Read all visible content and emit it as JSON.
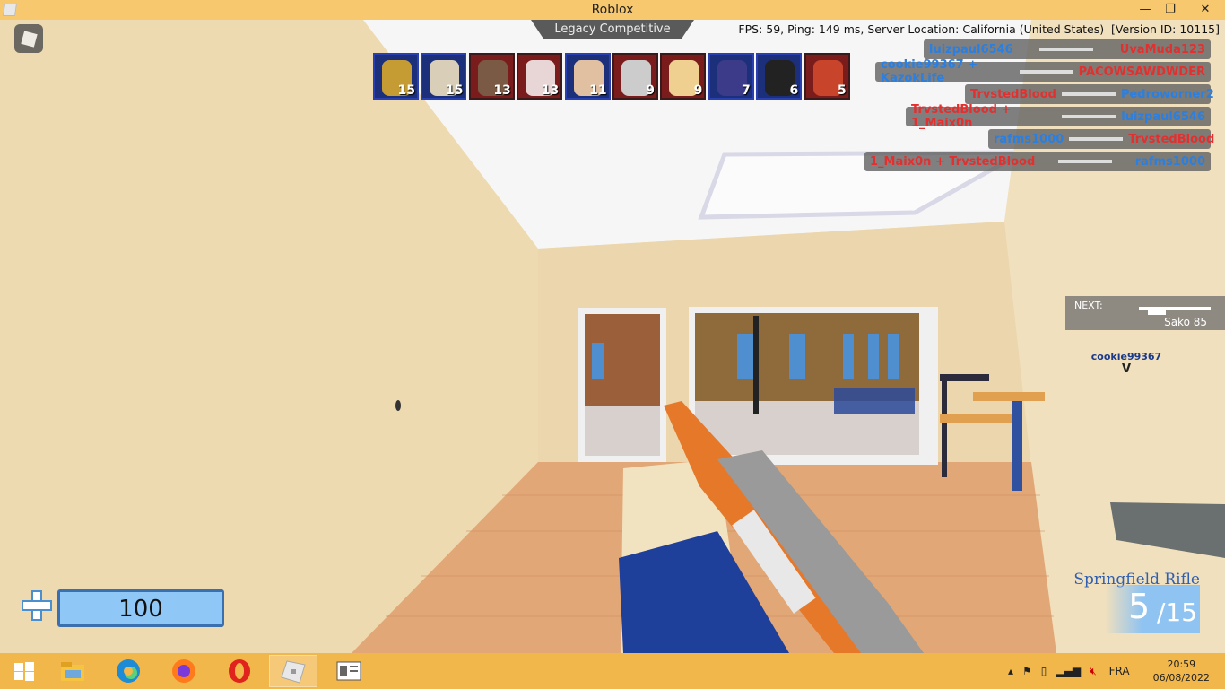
{
  "window": {
    "title": "Roblox",
    "min_icon": "minimize-icon",
    "max_icon": "maximize-icon",
    "close_icon": "close-icon"
  },
  "hud": {
    "mode": "Legacy Competitive",
    "stats": "FPS: 59, Ping: 149 ms, Server Location: California (United States)  [Version ID: 10115]",
    "players": [
      {
        "score": "15",
        "team": "blue",
        "face": "#c59b33"
      },
      {
        "score": "15",
        "team": "blue",
        "face": "#d9cfb8"
      },
      {
        "score": "13",
        "team": "red",
        "face": "#7a5a44"
      },
      {
        "score": "13",
        "team": "red",
        "face": "#e8d6d6"
      },
      {
        "score": "11",
        "team": "blue",
        "face": "#e0c0a0"
      },
      {
        "score": "9",
        "team": "red",
        "face": "#ccc"
      },
      {
        "score": "9",
        "team": "red",
        "face": "#f0d090"
      },
      {
        "score": "7",
        "team": "blue",
        "face": "#3b3b8a"
      },
      {
        "score": "6",
        "team": "blue",
        "face": "#222"
      },
      {
        "score": "5",
        "team": "red",
        "face": "#c8442a"
      }
    ],
    "killfeed": [
      {
        "killer": "luizpaul6546",
        "killer_team": "blue",
        "victim": "UvaMuda123",
        "victim_team": "red"
      },
      {
        "killer": "cookie99367 + KazokLife",
        "killer_team": "blue",
        "victim": "PACOWSAWDWDER",
        "victim_team": "red"
      },
      {
        "killer": "TrvstedBlood",
        "killer_team": "red",
        "victim": "Pedroworner2",
        "victim_team": "blue"
      },
      {
        "killer": "TrvstedBlood + 1_Maix0n",
        "killer_team": "red",
        "victim": "luizpaul6546",
        "victim_team": "blue"
      },
      {
        "killer": "rafms1000",
        "killer_team": "blue",
        "victim": "TrvstedBlood",
        "victim_team": "red"
      },
      {
        "killer": "1_Maix0n + TrvstedBlood",
        "killer_team": "red",
        "victim": "rafms1000",
        "victim_team": "blue"
      }
    ],
    "next_label": "NEXT:",
    "next_weapon": "Sako 85",
    "nametag": "cookie99367",
    "nametag_marker": "V",
    "health": "100",
    "health_fraction": 1.0,
    "weapon_name": "Springfield Rifle",
    "ammo": "5",
    "reserve": "/15"
  },
  "taskbar": {
    "lang": "FRA",
    "time": "20:59",
    "date": "06/08/2022",
    "apps": [
      "windows-start-icon",
      "file-explorer-icon",
      "edge-icon",
      "firefox-icon",
      "opera-icon",
      "roblox-icon",
      "roblox-studio-icon"
    ]
  },
  "colors": {
    "taskbar": "#f2b74a",
    "titlebar": "#f7c86e",
    "blue_team": "#2a7fe0",
    "red_team": "#e23030",
    "health_bar": "#8fc8f7"
  }
}
